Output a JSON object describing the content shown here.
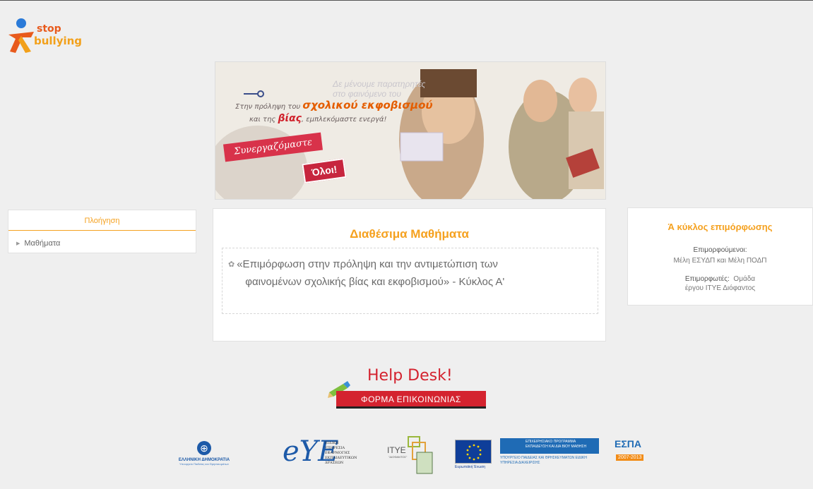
{
  "logo": {
    "line1": "stop",
    "line2": "bullying"
  },
  "banner": {
    "line1_pre": "Στην πρόληψη του ",
    "line1_hl": "σχολικού εκφοβισμού",
    "line2_pre": "και της ",
    "line2_hl": "βίας",
    "line2_post": ", εμπλεκόμαστε ενεργά!",
    "faded1": "Δε μένουμε παρατηρητές",
    "faded2": "στο φαινόμενο του",
    "ribbon1": "Συνεργαζόμαστε",
    "ribbon2": "Όλοι!"
  },
  "navigation": {
    "title": "Πλοήγηση",
    "items": [
      {
        "label": "Μαθήματα"
      }
    ]
  },
  "main": {
    "title": "Διαθέσιμα Μαθήματα",
    "courses": [
      {
        "title_line1": "«Επιμόρφωση στην πρόληψη και την αντιμετώπιση των",
        "title_line2": "φαινομένων σχολικής βίας και εκφοβισμού» - Κύκλος Α'"
      }
    ]
  },
  "info": {
    "title": "Ά κύκλος επιμόρφωσης",
    "trainees_label": "Επιμορφούμενοι:",
    "trainees_value": "Μέλη ΕΣΥΔΠ και Μέλη ΠΟΔΠ",
    "trainers_label": "Επιμορφωτές:",
    "trainers_value_1": "Ομάδα",
    "trainers_value_2": "έργου ΙΤΥΕ Διόφαντος"
  },
  "helpdesk": {
    "title": "Help Desk!",
    "button_label": "ΦΟΡΜΑ ΕΠΙΚΟΙΝΩΝΙΑΣ"
  },
  "footer_logos": {
    "greece_line1": "ΕΛΛΗΝΙΚΗ ΔΗΜΟΚΡΑΤΙΑ",
    "greece_line2": "Υπουργείο Παιδείας και Θρησκευμάτων",
    "eye_mark": "eYE",
    "eye_text": [
      "ΕΙΔΙΚΗ",
      "ΥΠΗΡΕΣΙΑ",
      "ΕΦΑΡΜΟΓΗΣ",
      "ΕΚΠΑΙΔΕΥΤΙΚΩΝ",
      "ΔΡΑΣΕΩΝ"
    ],
    "itye": "ΙΤΥΕ",
    "itye_sub": "\"ΔΙΟΦΑΝΤΟΣ\"",
    "eu": "Ευρωπαϊκή Ένωση",
    "epa_title": "ΕΠΙΧΕΙΡΗΣΙΑΚΟ ΠΡΟΓΡΑΜΜΑ ΕΚΠΑΙΔΕΥΣΗ ΚΑΙ ΔΙΑ ΒΙΟΥ ΜΑΘΗΣΗ",
    "epa_sub": "ΥΠΟΥΡΓΕΙΟ ΠΑΙΔΕΙΑΣ ΚΑΙ ΘΡΗΣΚΕΥΜΑΤΩΝ ΕΙΔΙΚΗ ΥΠΗΡΕΣΙΑ ΔΙΑΧΕΙΡΙΣΗΣ",
    "espa": "ΕΣΠΑ",
    "espa_years": "2007-2013"
  },
  "colors": {
    "accent": "#f5a11f",
    "red": "#d4232f",
    "blue": "#1d5aa8"
  }
}
